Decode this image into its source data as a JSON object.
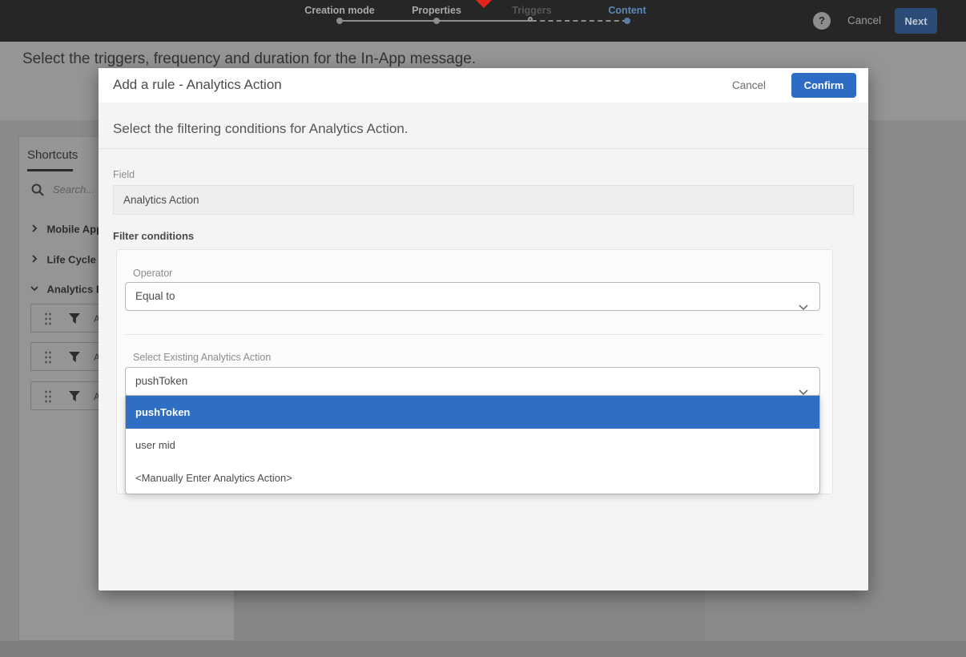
{
  "top_nav": {
    "steps": [
      {
        "label": "Creation mode",
        "state": "done"
      },
      {
        "label": "Properties",
        "state": "done"
      },
      {
        "label": "Triggers",
        "state": "pending"
      },
      {
        "label": "Content",
        "state": "active"
      }
    ],
    "help_label": "?",
    "cancel_label": "Cancel",
    "next_label": "Next"
  },
  "page": {
    "heading": "Select the triggers, frequency and duration for the In-App message.",
    "sidebar": {
      "tab": "Shortcuts",
      "search_placeholder": "Search...",
      "tree": [
        {
          "label": "Mobile Appl",
          "expanded": false
        },
        {
          "label": "Life Cycle Ev",
          "expanded": false
        },
        {
          "label": "Analytics Ev",
          "expanded": true
        }
      ],
      "cards": [
        {
          "label": "A"
        },
        {
          "label": "A"
        },
        {
          "label": "A"
        }
      ]
    }
  },
  "modal": {
    "title": "Add a rule - Analytics Action",
    "cancel_label": "Cancel",
    "confirm_label": "Confirm",
    "subtitle": "Select the filtering conditions for Analytics Action.",
    "field": {
      "label": "Field",
      "value": "Analytics Action"
    },
    "filter_conditions": {
      "heading": "Filter conditions",
      "operator_label": "Operator",
      "operator_value": "Equal to",
      "action_label": "Select Existing Analytics Action",
      "action_value": "pushToken",
      "options": [
        {
          "label": "pushToken",
          "selected": true
        },
        {
          "label": "user mid",
          "selected": false
        },
        {
          "label": "<Manually Enter Analytics Action>",
          "selected": false
        }
      ]
    }
  },
  "colors": {
    "topbar_bg": "#262626",
    "marker_red": "#e1251b",
    "confirm_blue": "#2d6cc4",
    "highlight_blue": "#2f6ec5"
  }
}
